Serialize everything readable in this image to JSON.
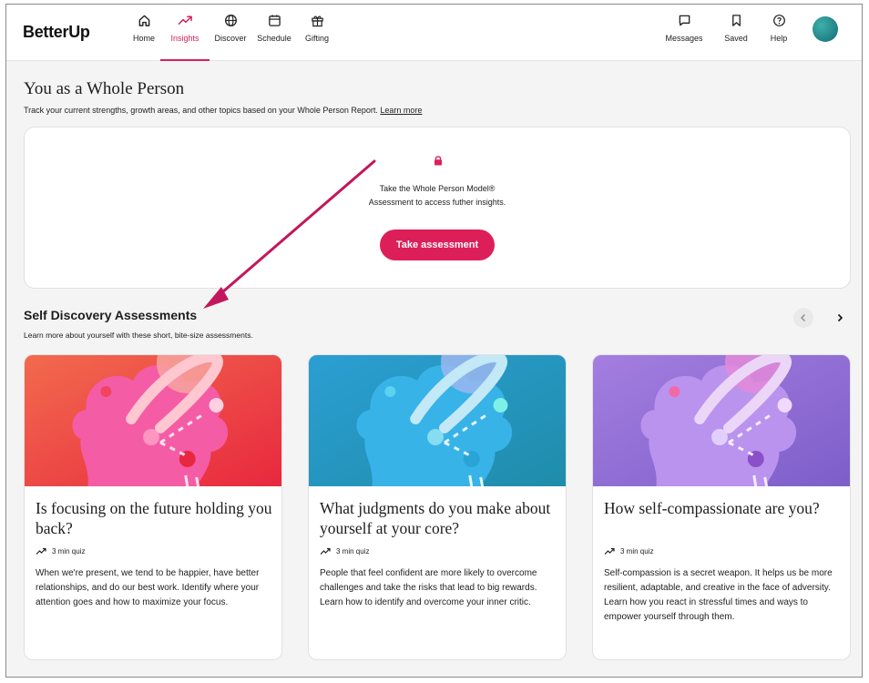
{
  "nav": {
    "logo": "BetterUp",
    "items": [
      {
        "label": "Home",
        "icon": "home-icon"
      },
      {
        "label": "Insights",
        "icon": "trend-up-icon",
        "active": true
      },
      {
        "label": "Discover",
        "icon": "globe-icon"
      },
      {
        "label": "Schedule",
        "icon": "calendar-icon"
      },
      {
        "label": "Gifting",
        "icon": "gift-icon"
      }
    ],
    "right_items": [
      {
        "label": "Messages",
        "icon": "message-icon"
      },
      {
        "label": "Saved",
        "icon": "bookmark-icon"
      },
      {
        "label": "Help",
        "icon": "help-icon"
      }
    ],
    "avatar": "user-avatar"
  },
  "whole_person": {
    "title": "You as a Whole Person",
    "subtitle": "Track your current strengths, growth areas, and other topics based on your Whole Person Report.",
    "learn_more": "Learn more",
    "locked_line1": "Take the Whole Person Model®",
    "locked_line2": "Assessment to access futher insights.",
    "button": "Take assessment"
  },
  "self_discovery": {
    "title": "Self Discovery Assessments",
    "subtitle": "Learn more about yourself with these short, bite-size assessments.",
    "cards": [
      {
        "title": "Is focusing on the future holding you back?",
        "meta": "3 min quiz",
        "description": "When we're present, we tend to be happier, have better relationships, and do our best work. Identify where your attention goes and how to maximize your focus."
      },
      {
        "title": "What judgments do you make about yourself at your core?",
        "meta": "3 min quiz",
        "description": "People that feel confident are more likely to overcome challenges and take the risks that lead to big rewards. Learn how to identify and overcome your inner critic."
      },
      {
        "title": "How self-compassionate are you?",
        "meta": "3 min quiz",
        "description": "Self-compassion is a secret weapon. It helps us be more resilient, adaptable, and creative in the face of adversity. Learn how you react in stressful times and ways to empower yourself through them."
      }
    ]
  },
  "colors": {
    "accent": "#dd1f59",
    "card1": "#ef3d5a",
    "card2": "#2b9fd3",
    "card3": "#a47ee0"
  }
}
